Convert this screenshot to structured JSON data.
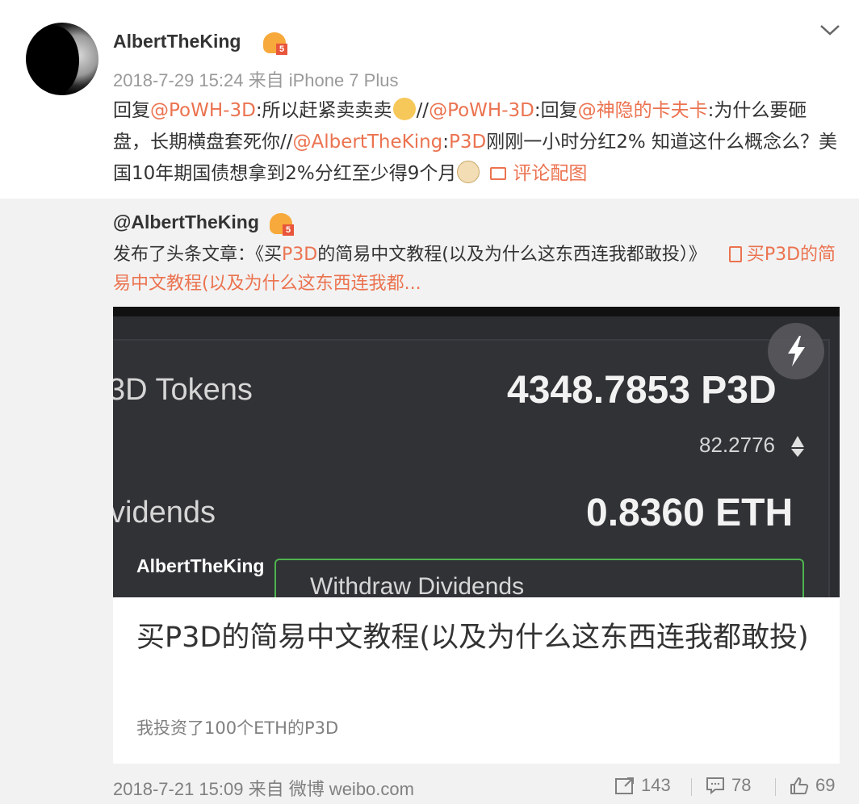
{
  "post": {
    "username": "AlbertTheKing",
    "meta": "2018-7-29 15:24 来自 iPhone 7 Plus",
    "segments": {
      "s1": "回复",
      "s2": "@PoWH-3D",
      "s3": ":所以赶紧卖卖卖",
      "s4": "//",
      "s5": "@PoWH-3D",
      "s6": ":回复",
      "s7": "@神隐的卡夫卡",
      "s8": ":为什么要砸盘，长期横盘套死你//",
      "s9": "@AlbertTheKing",
      "s10": ":",
      "s11": "P3D",
      "s12": "刚刚一小时分红2% 知道这什么概念么？美国10年期国债想拿到2%分红至少得9个月"
    },
    "image_link": "评论配图"
  },
  "repost": {
    "username": "@AlbertTheKing",
    "text": {
      "t1": "发布了头条文章：《买",
      "t2": "P3D",
      "t3": "的简易中文教程(以及为什么这东西连我都敢投）》",
      "link": "买P3D的简易中文教程(以及为什么这东西连我都..."
    },
    "card": {
      "cover": {
        "tokens_label": "3D Tokens",
        "tokens_value": "4348.7853 P3D",
        "eth_small": "82.2776",
        "dividends_label": "vidends",
        "dividends_value": "0.8360 ETH",
        "withdraw": "Withdraw Dividends"
      },
      "author": "AlbertTheKing",
      "title": "买P3D的简易中文教程(以及为什么这东西连我都敢投)",
      "desc": "我投资了100个ETH的P3D"
    },
    "footer": {
      "time": "2018-7-21 15:09 来自 微博 weibo.com",
      "reposts": "143",
      "comments": "78",
      "likes": "69"
    }
  },
  "colors": {
    "mention": "#eb7350",
    "repost_bg": "#f2f2f2",
    "meta_gray": "#9a9a9a"
  },
  "icons": [
    "chevron-down-icon",
    "vip-badge-icon",
    "picture-icon",
    "article-icon",
    "flash-icon",
    "repost-icon",
    "comment-icon",
    "like-icon"
  ]
}
